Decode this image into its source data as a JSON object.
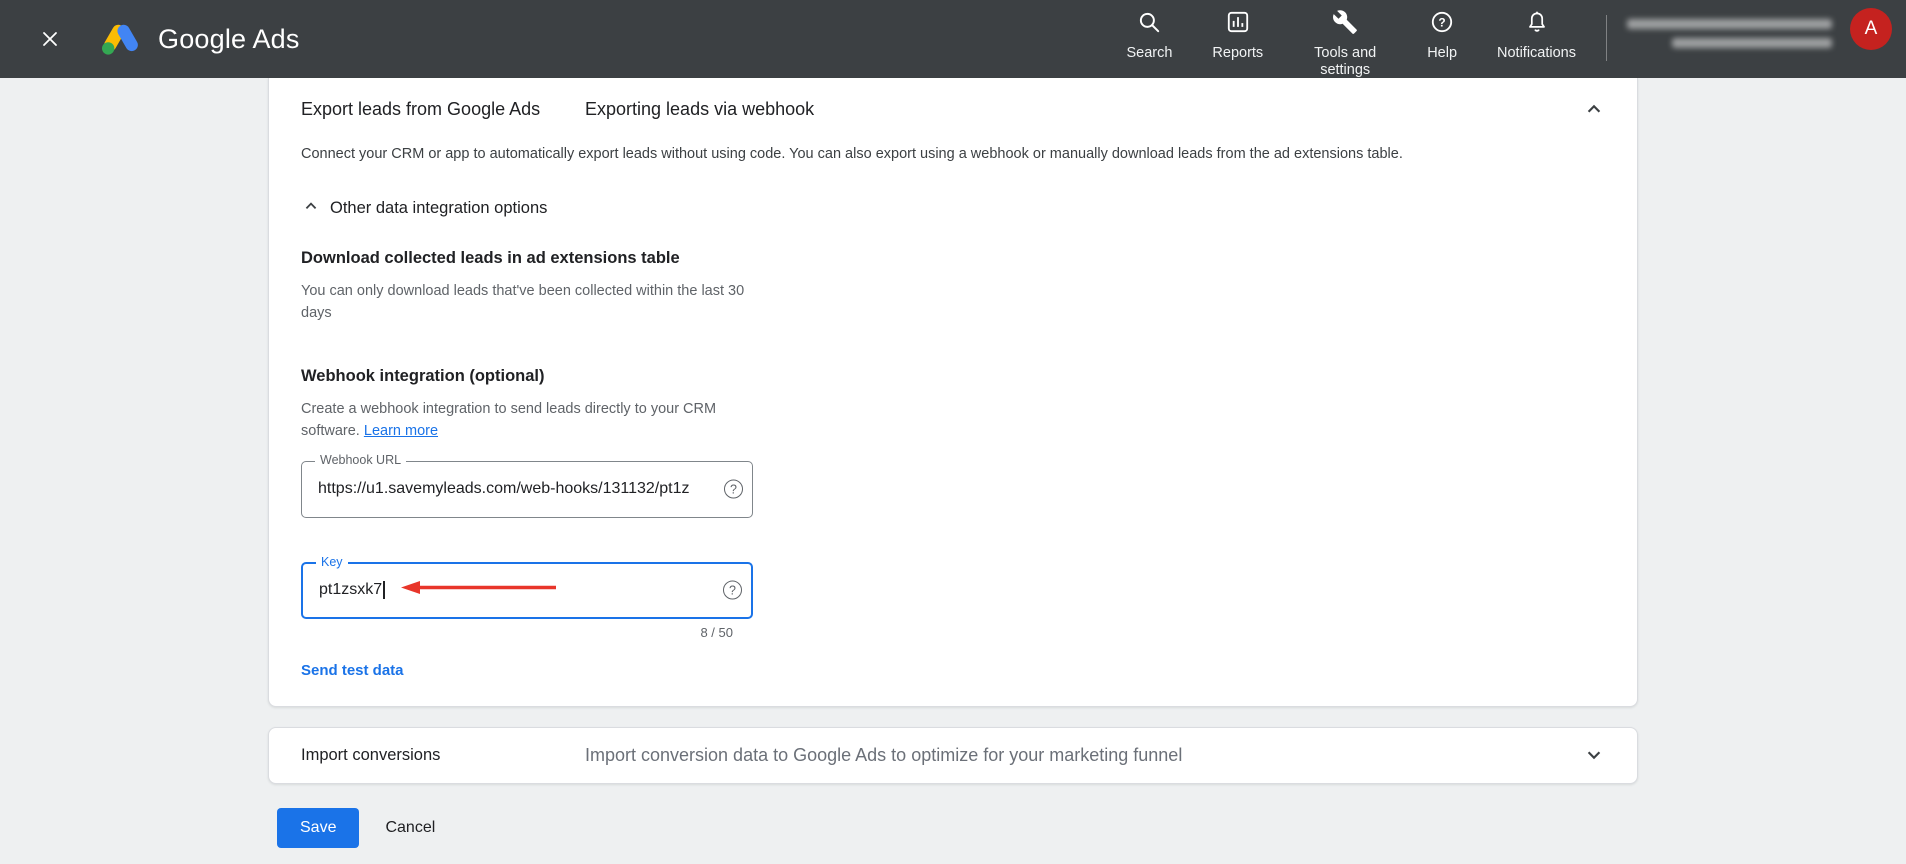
{
  "header": {
    "app_title": "Google Ads",
    "nav": [
      {
        "label": "Search"
      },
      {
        "label": "Reports"
      },
      {
        "label": "Tools and settings"
      },
      {
        "label": "Help"
      },
      {
        "label": "Notifications"
      }
    ],
    "avatar_letter": "A"
  },
  "export_card": {
    "title": "Export leads from Google Ads",
    "subtitle": "Exporting leads via webhook",
    "description": "Connect your CRM or app to automatically export leads without using code. You can also export using a webhook or manually download leads from the ad extensions table.",
    "other_options_label": "Other data integration options",
    "download_section": {
      "title": "Download collected leads in ad extensions table",
      "description": "You can only download leads that've been collected within the last 30 days"
    },
    "webhook_section": {
      "title": "Webhook integration (optional)",
      "description": "Create a webhook integration to send leads directly to your CRM software.",
      "learn_more_label": "Learn more",
      "url_field": {
        "label": "Webhook URL",
        "value": "https://u1.savemyleads.com/web-hooks/131132/pt1z"
      },
      "key_field": {
        "label": "Key",
        "value": "pt1zsxk7",
        "counter": "8 / 50"
      },
      "send_test_label": "Send test data"
    }
  },
  "import_card": {
    "title": "Import conversions",
    "description": "Import conversion data to Google Ads to optimize for your marketing funnel"
  },
  "actions": {
    "save_label": "Save",
    "cancel_label": "Cancel"
  },
  "icons": {
    "close": "x-cross",
    "search": "magnifier",
    "reports": "bar-chart-square",
    "tools": "wrench",
    "help": "question-circle",
    "notifications": "bell",
    "chevron_up": "^",
    "chevron_down": "v",
    "field_help": "?"
  },
  "colors": {
    "header_bg": "#3c4043",
    "accent_blue": "#1a73e8",
    "avatar_red": "#c5221f",
    "arrow_red": "#e8352a",
    "logo_yellow": "#fbbc04",
    "logo_blue": "#4285f4",
    "logo_green": "#34a853",
    "page_bg": "#eef0f1",
    "border_gray": "#dadce0"
  }
}
